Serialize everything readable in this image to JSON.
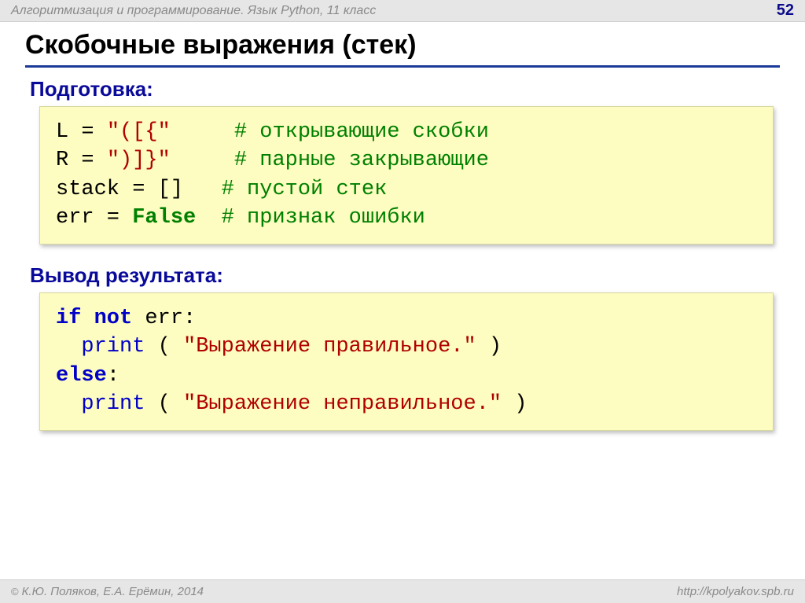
{
  "header": {
    "course": "Алгоритмизация и программирование. Язык Python, 11 класс",
    "page": "52"
  },
  "title": "Скобочные выражения (стек)",
  "sections": {
    "prep_label": "Подготовка:",
    "result_label": "Вывод результата:"
  },
  "code1": {
    "l1a": "L = ",
    "l1b": "\"([{\"",
    "l1pad": "     ",
    "l1c": "# открывающие скобки",
    "l2a": "R = ",
    "l2b": "\")]}\"",
    "l2pad": "     ",
    "l2c": "# парные закрывающие",
    "l3a": "stack = []   ",
    "l3c": "# пустой стек",
    "l4a": "err = ",
    "l4b": "False",
    "l4pad": "  ",
    "l4c": "# признак ошибки"
  },
  "code2": {
    "if": "if",
    "not": "not",
    "err": " err:",
    "print": "print",
    "open": " ( ",
    "close": " )",
    "s1": "\"Выражение правильное.\"",
    "else": "else",
    "colon": ":",
    "s2": "\"Выражение неправильное.\"",
    "sp_not": " ",
    "indent": "  "
  },
  "footer": {
    "copyright": "К.Ю. Поляков, Е.А. Ерёмин, 2014",
    "url": "http://kpolyakov.spb.ru"
  }
}
